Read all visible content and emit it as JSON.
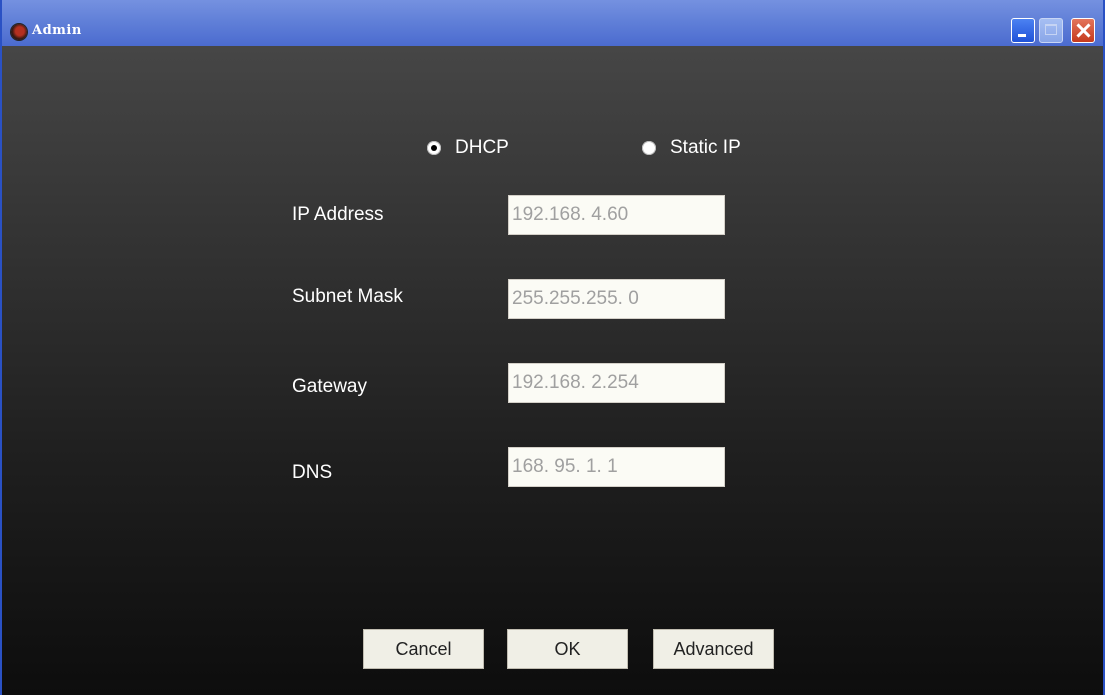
{
  "window": {
    "title": "Admin"
  },
  "network": {
    "mode_options": [
      {
        "label": "DHCP",
        "selected": true
      },
      {
        "label": "Static IP",
        "selected": false
      }
    ],
    "fields": {
      "ip_address": {
        "label": "IP Address",
        "value": "192.168.  4.60"
      },
      "subnet_mask": {
        "label": "Subnet Mask",
        "value": "255.255.255.  0"
      },
      "gateway": {
        "label": "Gateway",
        "value": "192.168.  2.254"
      },
      "dns": {
        "label": "DNS",
        "value": "168. 95.  1.  1"
      }
    }
  },
  "buttons": {
    "cancel": "Cancel",
    "ok": "OK",
    "advanced": "Advanced"
  },
  "colors": {
    "titlebar": "#6382d9",
    "close": "#c6391c",
    "field_text": "#a0a0a0"
  }
}
